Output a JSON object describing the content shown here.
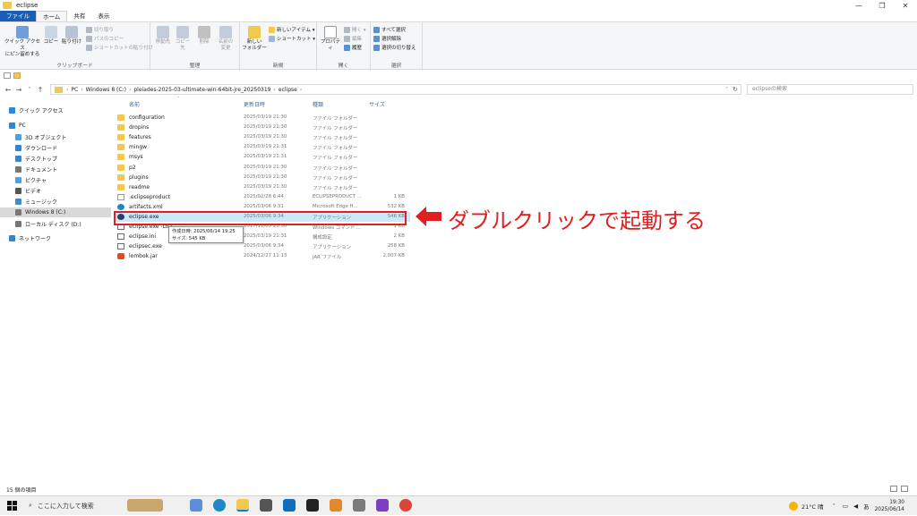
{
  "window": {
    "title": "eclipse",
    "controls": [
      "—",
      "❐",
      "✕"
    ]
  },
  "ribbon": {
    "tabs": [
      "ファイル",
      "ホーム",
      "共有",
      "表示"
    ],
    "groups": {
      "clipboard": {
        "label": "クリップボード",
        "pin": "クイック アクセス\nにピン留めする",
        "copy": "コピー",
        "paste": "貼り付け",
        "cut": "切り取り",
        "copy_path": "パスのコピー",
        "paste_shortcut": "ショートカットの貼り付け"
      },
      "organize": {
        "label": "整理",
        "move_to": "移動先",
        "copy_to": "コピー先",
        "delete": "削除",
        "rename": "名前の\n変更"
      },
      "new": {
        "label": "新規",
        "new_folder": "新しい\nフォルダー",
        "new_item": "新しいアイテム ▾",
        "easy_access": "ショートカット ▾"
      },
      "open": {
        "label": "開く",
        "properties": "プロパティ",
        "open": "開く ▾",
        "edit": "編集",
        "history": "履歴"
      },
      "select": {
        "label": "選択",
        "select_all": "すべて選択",
        "select_none": "選択解除",
        "invert": "選択の切り替え"
      }
    }
  },
  "address": {
    "crumbs": [
      "PC",
      "Windows 8 (C:)",
      "pleiades-2025-03-ultimate-win-64bit-jre_20250319",
      "eclipse"
    ],
    "search_placeholder": "eclipseの検索"
  },
  "nav": {
    "items": [
      {
        "label": "クイック アクセス",
        "icon": "star-icon",
        "color": "#2f86d8"
      },
      {
        "label": "PC",
        "icon": "pc-icon",
        "color": "#2f86d8"
      },
      {
        "label": "3D オブジェクト",
        "icon": "cube-icon",
        "color": "#4aa3df"
      },
      {
        "label": "ダウンロード",
        "icon": "download-icon",
        "color": "#2f86d8"
      },
      {
        "label": "デスクトップ",
        "icon": "desktop-icon",
        "color": "#2f86d8"
      },
      {
        "label": "ドキュメント",
        "icon": "document-icon",
        "color": "#777777"
      },
      {
        "label": "ピクチャ",
        "icon": "picture-icon",
        "color": "#4aa3df"
      },
      {
        "label": "ビデオ",
        "icon": "video-icon",
        "color": "#555555"
      },
      {
        "label": "ミュージック",
        "icon": "music-icon",
        "color": "#3b8bd6"
      },
      {
        "label": "Windows 8 (C:)",
        "icon": "drive-icon",
        "color": "#777777"
      },
      {
        "label": "ローカル ディスク (D:)",
        "icon": "drive-icon",
        "color": "#777777"
      },
      {
        "label": "ネットワーク",
        "icon": "network-icon",
        "color": "#2f86d8"
      }
    ]
  },
  "columns": {
    "name": "名前",
    "date": "更新日時",
    "type": "種類",
    "size": "サイズ"
  },
  "files": [
    {
      "name": "configuration",
      "date": "2025/03/19 21:30",
      "type": "ファイル フォルダー",
      "size": "",
      "icon": "folder"
    },
    {
      "name": "dropins",
      "date": "2025/03/19 21:30",
      "type": "ファイル フォルダー",
      "size": "",
      "icon": "folder"
    },
    {
      "name": "features",
      "date": "2025/03/19 21:30",
      "type": "ファイル フォルダー",
      "size": "",
      "icon": "folder"
    },
    {
      "name": "mingw",
      "date": "2025/03/19 21:31",
      "type": "ファイル フォルダー",
      "size": "",
      "icon": "folder"
    },
    {
      "name": "msys",
      "date": "2025/03/19 21:31",
      "type": "ファイル フォルダー",
      "size": "",
      "icon": "folder"
    },
    {
      "name": "p2",
      "date": "2025/03/19 21:30",
      "type": "ファイル フォルダー",
      "size": "",
      "icon": "folder"
    },
    {
      "name": "plugins",
      "date": "2025/03/19 21:30",
      "type": "ファイル フォルダー",
      "size": "",
      "icon": "folder"
    },
    {
      "name": "readme",
      "date": "2025/03/19 21:30",
      "type": "ファイル フォルダー",
      "size": "",
      "icon": "folder"
    },
    {
      "name": ".eclipseproduct",
      "date": "2025/02/28 6:44",
      "type": "ECLIPSEPRODUCT ...",
      "size": "1 KB",
      "icon": "doc"
    },
    {
      "name": "artifacts.xml",
      "date": "2025/03/06 9:31",
      "type": "Microsoft Edge H...",
      "size": "532 KB",
      "icon": "edge"
    },
    {
      "name": "eclipse.exe",
      "date": "2025/03/06 9:34",
      "type": "アプリケーション",
      "size": "546 KB",
      "icon": "exe"
    },
    {
      "name": "eclipse.exe -Loa...",
      "date": "2017/11/03 23:50",
      "type": "Windows コマンド ...",
      "size": "1 KB",
      "icon": "cfg"
    },
    {
      "name": "eclipse.ini",
      "date": "2025/03/19 21:31",
      "type": "構成設定",
      "size": "2 KB",
      "icon": "cfg"
    },
    {
      "name": "eclipsec.exe",
      "date": "2025/03/06 9:34",
      "type": "アプリケーション",
      "size": "258 KB",
      "icon": "cfg"
    },
    {
      "name": "lombok.jar",
      "date": "2024/12/27 11:13",
      "type": "JAR ファイル",
      "size": "2,007 KB",
      "icon": "jar"
    }
  ],
  "tooltip": {
    "line1": "作成日時: 2025/06/14 19:25",
    "line2": "サイズ: 545 KB"
  },
  "annotation": {
    "text": "ダブルクリックで起動する",
    "color": "#e02020"
  },
  "status": {
    "count": "15 個の項目"
  },
  "taskbar": {
    "search_placeholder": "ここに入力して検索",
    "weather": "21°C 晴",
    "time": "19:30",
    "date": "2025/06/14",
    "ime": "あ"
  }
}
